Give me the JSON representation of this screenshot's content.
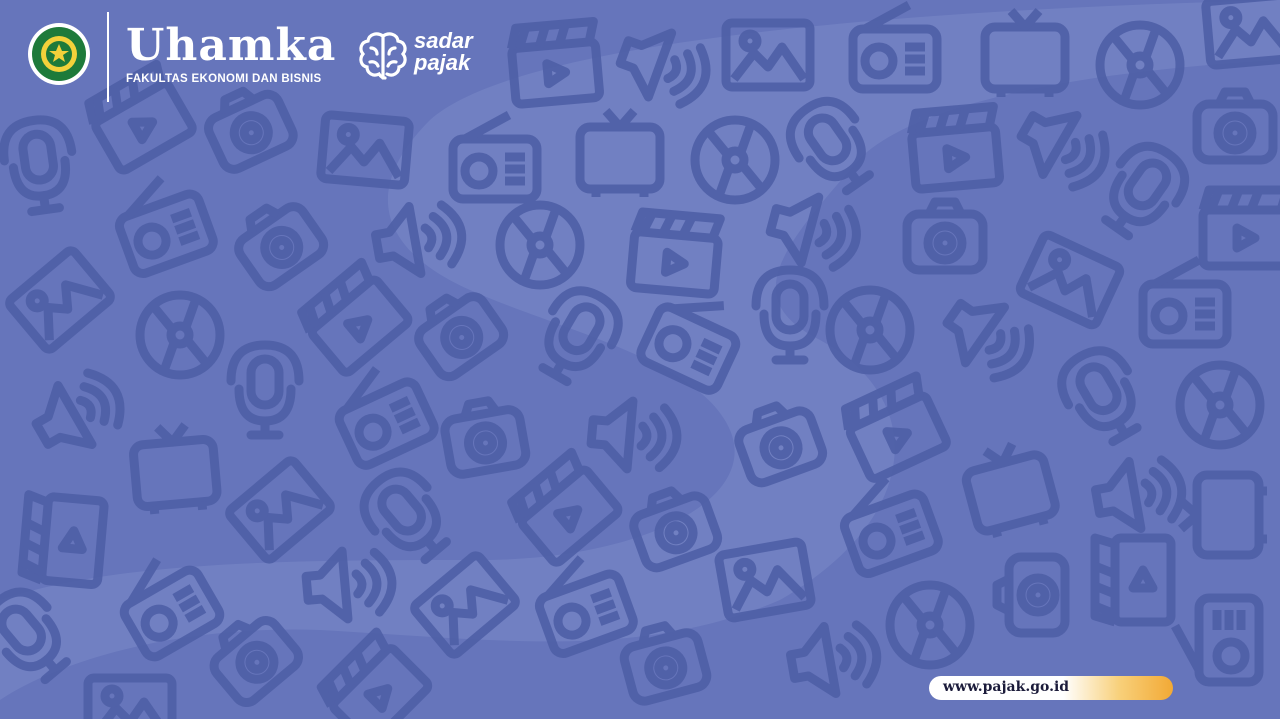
{
  "header": {
    "brand_name": "Uhamka",
    "faculty": "FAKULTAS EKONOMI DAN BISNIS",
    "campaign_line1": "sadar",
    "campaign_line2": "pajak"
  },
  "footer": {
    "website": "www.pajak.go.id"
  },
  "colors": {
    "background": "#6675bb",
    "icon_pattern": "#4f5fa6",
    "highlight_blob": "#7b88c6",
    "url_gradient_end": "#f2a935"
  },
  "pattern_icons": [
    "camera-icon",
    "microphone-icon",
    "radio-icon",
    "tv-icon",
    "cd-icon",
    "film-icon",
    "image-icon",
    "speaker-icon"
  ]
}
